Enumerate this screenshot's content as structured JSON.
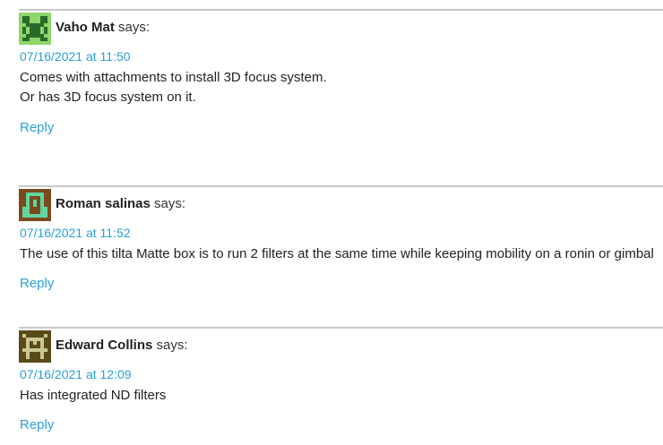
{
  "comments": [
    {
      "author": "Vaho Mat",
      "says": "says:",
      "date": "07/16/2021 at 11:50",
      "lines": [
        "Comes with attachments to install 3D focus system.",
        "Or has 3D focus system on it."
      ],
      "reply": "Reply",
      "avatar_icon": "pixel-identicon-icon",
      "avatar_fg": "#8fd66a",
      "avatar_bg": "#2a6a2a"
    },
    {
      "author": "Roman salinas",
      "says": "says:",
      "date": "07/16/2021 at 11:52",
      "lines": [
        "The use of this tilta Matte box is to run 2 filters at the same time while keeping mobility on a ronin or gimbal"
      ],
      "reply": "Reply",
      "avatar_icon": "pixel-identicon-icon",
      "avatar_fg": "#5fd6a0",
      "avatar_bg": "#7a4a1e"
    },
    {
      "author": "Edward Collins",
      "says": "says:",
      "date": "07/16/2021 at 12:09",
      "lines": [
        "Has integrated ND filters"
      ],
      "reply": "Reply",
      "avatar_icon": "pixel-identicon-icon",
      "avatar_fg": "#c8c890",
      "avatar_bg": "#5a4a1a"
    }
  ],
  "colors": {
    "link": "#2a9fd6",
    "divider": "#c8c8c8",
    "text": "#222222"
  }
}
